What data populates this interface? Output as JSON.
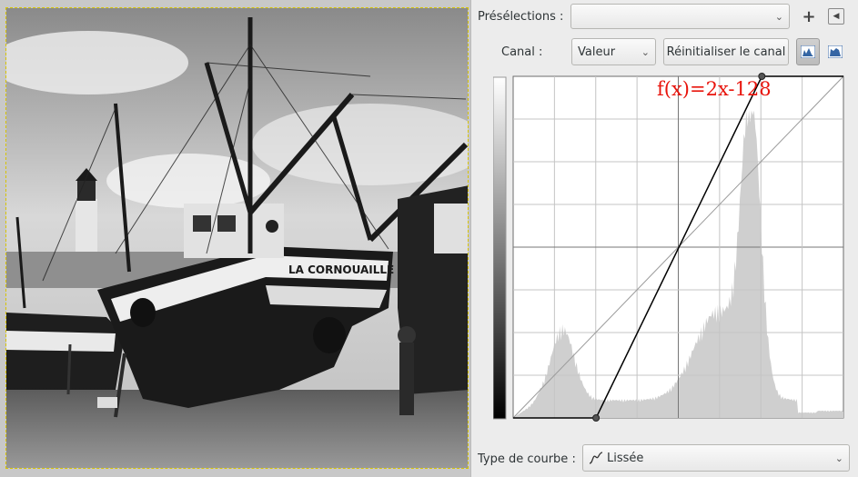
{
  "dialog": {
    "presets_label": "Présélections :",
    "presets_value": "",
    "channel_label": "Canal :",
    "channel_value": "Valeur",
    "reset_button": "Réinitialiser le canal",
    "curve_type_label": "Type de courbe :",
    "curve_type_value": "Lissée",
    "icons": [
      "add-icon",
      "menu-icon",
      "linear-histogram-icon",
      "log-histogram-icon",
      "smooth-curve-icon",
      "chevron-down-icon"
    ]
  },
  "curve": {
    "formula": "f(x)=2x-128",
    "control_points": [
      [
        64,
        0
      ],
      [
        192,
        255
      ]
    ],
    "range": [
      0,
      255
    ],
    "curve_color": "#000000",
    "histogram_color": "#cfcfcf",
    "formula_color": "#e8140c"
  },
  "photo": {
    "boat_name": "LA CORNOUAILLE"
  }
}
